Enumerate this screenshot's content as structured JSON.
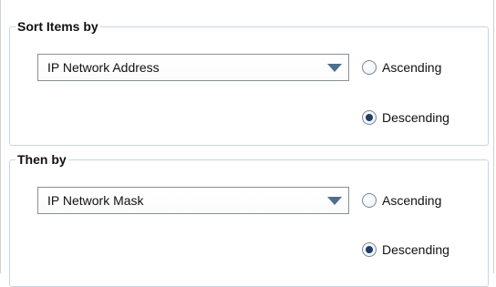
{
  "sort_primary": {
    "group_label": "Sort Items by",
    "field": "IP Network Address",
    "order_options": [
      "Ascending",
      "Descending"
    ],
    "selected_order": "Descending"
  },
  "sort_secondary": {
    "group_label": "Then by",
    "field": "IP Network Mask",
    "order_options": [
      "Ascending",
      "Descending"
    ],
    "selected_order": "Descending"
  }
}
